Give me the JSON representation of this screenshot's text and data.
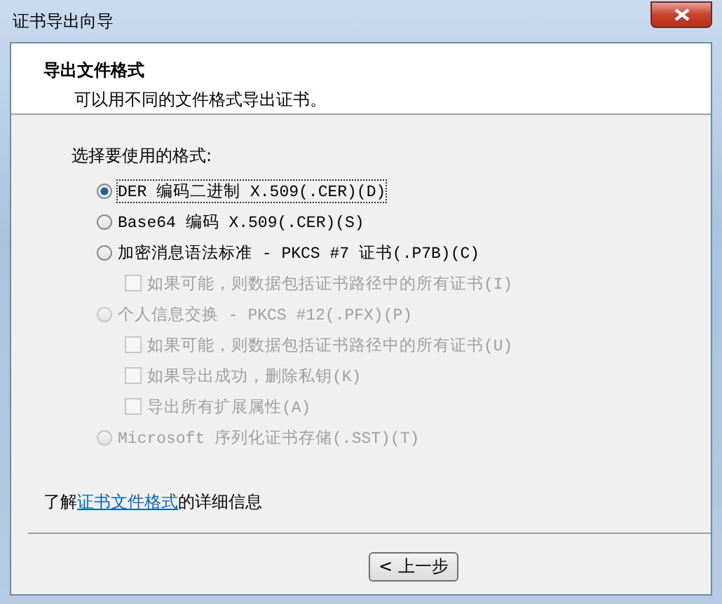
{
  "window": {
    "title": "证书导出向导"
  },
  "header": {
    "title": "导出文件格式",
    "subtitle": "可以用不同的文件格式导出证书。"
  },
  "group_label": "选择要使用的格式:",
  "options": [
    {
      "label": "DER 编码二进制 X.509(.CER)(D)",
      "selected": true,
      "disabled": false
    },
    {
      "label": "Base64 编码 X.509(.CER)(S)",
      "selected": false,
      "disabled": false
    },
    {
      "label": "加密消息语法标准 - PKCS #7 证书(.P7B)(C)",
      "selected": false,
      "disabled": false,
      "children": [
        {
          "label": "如果可能，则数据包括证书路径中的所有证书(I)",
          "checked": false,
          "disabled": true
        }
      ]
    },
    {
      "label": "个人信息交换 - PKCS #12(.PFX)(P)",
      "selected": false,
      "disabled": true,
      "children": [
        {
          "label": "如果可能，则数据包括证书路径中的所有证书(U)",
          "checked": false,
          "disabled": true
        },
        {
          "label": "如果导出成功，删除私钥(K)",
          "checked": false,
          "disabled": true
        },
        {
          "label": "导出所有扩展属性(A)",
          "checked": false,
          "disabled": true
        }
      ]
    },
    {
      "label": "Microsoft 序列化证书存储(.SST)(T)",
      "selected": false,
      "disabled": true
    }
  ],
  "info": {
    "prefix": "了解",
    "link": "证书文件格式",
    "suffix": "的详细信息"
  },
  "buttons": [
    "< 上一步"
  ]
}
